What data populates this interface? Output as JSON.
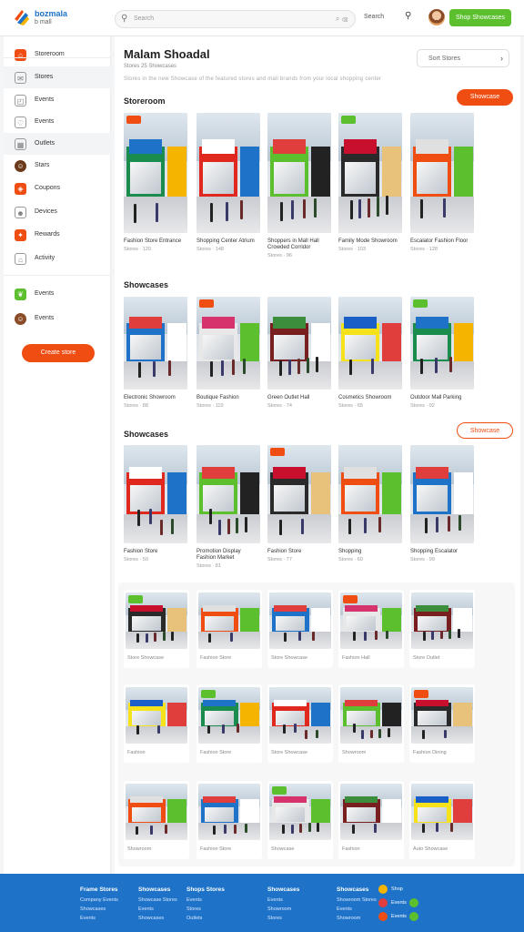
{
  "app": {
    "brand_line1": "bozmala",
    "brand_line2": "b mall"
  },
  "topbar": {
    "search_placeholder": "Search",
    "search_right": "⌕ ⌫",
    "link": "Search",
    "cta": "Shop Showcases"
  },
  "sidebar": {
    "items": [
      {
        "label": "Storeroom",
        "icon": "store-icon",
        "color": "#f04d12"
      },
      {
        "label": "Stores",
        "icon": "chat-icon",
        "color": "#777"
      },
      {
        "label": "Events",
        "icon": "bag-icon",
        "color": "#777"
      },
      {
        "label": "Events",
        "icon": "heart-icon",
        "color": "#777"
      },
      {
        "label": "Outlets",
        "icon": "grid-icon",
        "color": "#777"
      },
      {
        "label": "Stars",
        "icon": "people-icon",
        "color": "#6b3a1a"
      },
      {
        "label": "Coupons",
        "icon": "coupon-icon",
        "color": "#f04d12"
      },
      {
        "label": "Devices",
        "icon": "person-icon",
        "color": "#777"
      },
      {
        "label": "Rewards",
        "icon": "gift-icon",
        "color": "#f04d12"
      },
      {
        "label": "Activity",
        "icon": "home-icon",
        "color": "#777"
      },
      {
        "label": "Events",
        "icon": "leaf-icon",
        "color": "#5bbf2e"
      },
      {
        "label": "Events",
        "icon": "user-avatar-icon",
        "color": "#8a4b26"
      }
    ],
    "cta": "Create store"
  },
  "main": {
    "title": "Malam Shoadal",
    "subtitle": "Stores  25  Showcases",
    "description": "Stores in the new Showcase of the featured stores and mall brands from your local shopping center",
    "filter_label": "Sort Stores",
    "sections": [
      {
        "title": "Storeroom",
        "button": "Showcase",
        "button_style": "solid"
      },
      {
        "title": "Showcases",
        "button": "",
        "button_style": ""
      },
      {
        "title": "Showcases",
        "button": "Showcase",
        "button_style": "outline"
      }
    ],
    "row1": [
      {
        "caption": "Fashion Store Entrance",
        "meta": "Stores · 120"
      },
      {
        "caption": "Shopping Center Atrium",
        "meta": "Stores · 148"
      },
      {
        "caption": "Shoppers in Mall Hall Crowded Corridor",
        "meta": "Stores · 96"
      },
      {
        "caption": "Family Mode Showroom",
        "meta": "Stores · 103"
      },
      {
        "caption": "Escalator Fashion Floor",
        "meta": "Stores · 128"
      }
    ],
    "row2": [
      {
        "caption": "Electronic Showroom",
        "meta": "Stores · 88"
      },
      {
        "caption": "Boutique Fashion",
        "meta": "Stores · 110"
      },
      {
        "caption": "Green Outlet Hall",
        "meta": "Stores · 74"
      },
      {
        "caption": "Cosmetics Showroom",
        "meta": "Stores · 65"
      },
      {
        "caption": "Outdoor Mall Parking",
        "meta": "Stores · 92"
      }
    ],
    "row3": [
      {
        "caption": "Fashion Store",
        "meta": "Stores · 50"
      },
      {
        "caption": "Promotion Display Fashion Market",
        "meta": "Stores · 81"
      },
      {
        "caption": "Fashion Store",
        "meta": "Stores · 77"
      },
      {
        "caption": "Shopping",
        "meta": "Stores · 60"
      },
      {
        "caption": "Shopping Escalator",
        "meta": "Stores · 99"
      }
    ],
    "grid": [
      "Store Showcase",
      "Fashion Store",
      "Store Showcase",
      "Fashion Hall",
      "Store Outlet",
      "Fashion",
      "Fashion Store",
      "Store Showcase",
      "Showroom",
      "Fashion Dining",
      "Showroom",
      "Fashion Store",
      "Showcase",
      "Fashion",
      "Auto Showcase"
    ]
  },
  "footer": {
    "cols": [
      {
        "head": "Frame Stores",
        "links": [
          "Company Events",
          "Showcases",
          "Events"
        ]
      },
      {
        "head": "Showcases",
        "links": [
          "Showcase Stores",
          "Events",
          "Showcases"
        ]
      },
      {
        "head": "Shops Stores",
        "links": [
          "Events",
          "Stores",
          "Outlets"
        ]
      },
      {
        "head": "Showcases",
        "links": [
          "Events",
          "Showroom",
          "Stores"
        ]
      },
      {
        "head": "Showcases",
        "links": [
          "Showroom Stores",
          "Events",
          "Showroom"
        ]
      }
    ],
    "social": [
      "Shop",
      "Events",
      "Events"
    ]
  }
}
